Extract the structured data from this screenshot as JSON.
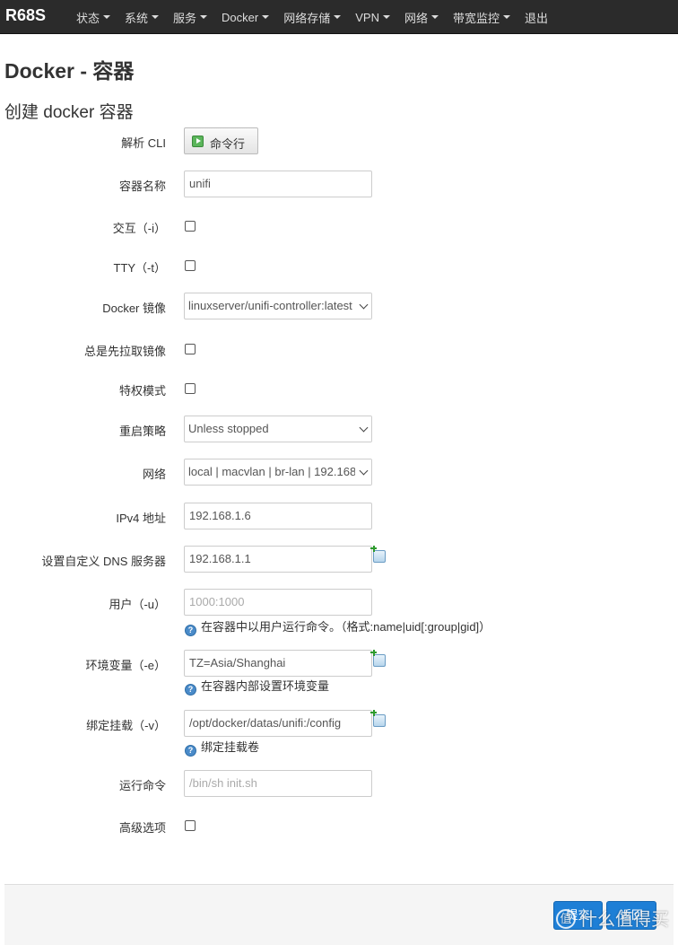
{
  "nav": {
    "brand": "R68S",
    "items": [
      {
        "label": "状态",
        "dropdown": true
      },
      {
        "label": "系统",
        "dropdown": true
      },
      {
        "label": "服务",
        "dropdown": true
      },
      {
        "label": "Docker",
        "dropdown": true
      },
      {
        "label": "网络存储",
        "dropdown": true
      },
      {
        "label": "VPN",
        "dropdown": true
      },
      {
        "label": "网络",
        "dropdown": true
      },
      {
        "label": "带宽监控",
        "dropdown": true
      },
      {
        "label": "退出",
        "dropdown": false
      }
    ]
  },
  "page_title": "Docker - 容器",
  "section_title": "创建 docker 容器",
  "form": {
    "cli": {
      "label": "解析 CLI",
      "button": "命令行"
    },
    "name": {
      "label": "容器名称",
      "value": "unifi"
    },
    "interactive": {
      "label": "交互（-i）",
      "checked": false
    },
    "tty": {
      "label": "TTY（-t）",
      "checked": false
    },
    "image": {
      "label": "Docker 镜像",
      "value": "linuxserver/unifi-controller:latest"
    },
    "pull": {
      "label": "总是先拉取镜像",
      "checked": false
    },
    "privileged": {
      "label": "特权模式",
      "checked": false
    },
    "restart": {
      "label": "重启策略",
      "value": "Unless stopped"
    },
    "network": {
      "label": "网络",
      "value": "local | macvlan | br-lan | 192.168"
    },
    "ipv4": {
      "label": "IPv4 地址",
      "value": "192.168.1.6"
    },
    "dns": {
      "label": "设置自定义 DNS 服务器",
      "value": "192.168.1.1"
    },
    "user": {
      "label": "用户（-u）",
      "placeholder": "1000:1000",
      "help": "在容器中以用户运行命令。（格式:name|uid[:group|gid]）"
    },
    "env": {
      "label": "环境变量（-e）",
      "value": "TZ=Asia/Shanghai",
      "help": "在容器内部设置环境变量"
    },
    "volume": {
      "label": "绑定挂载（-v）",
      "value": "/opt/docker/datas/unifi:/config",
      "help": "绑定挂载卷"
    },
    "command": {
      "label": "运行命令",
      "placeholder": "/bin/sh init.sh"
    },
    "advanced": {
      "label": "高级选项",
      "checked": false
    }
  },
  "footer": {
    "submit_label": "提交",
    "back_label": "返回"
  },
  "watermark": {
    "circle": "值",
    "text": "什么值得买"
  },
  "colors": {
    "navbar": "#2b2b2b",
    "primary_button": "#1e7fd6",
    "help_icon": "#4a8bc9",
    "add_icon": "#2e9b2e"
  },
  "icons": {
    "cli_button": "play-icon",
    "add": "add-icon",
    "help": "help-icon",
    "dropdown": "caret-down-icon"
  }
}
